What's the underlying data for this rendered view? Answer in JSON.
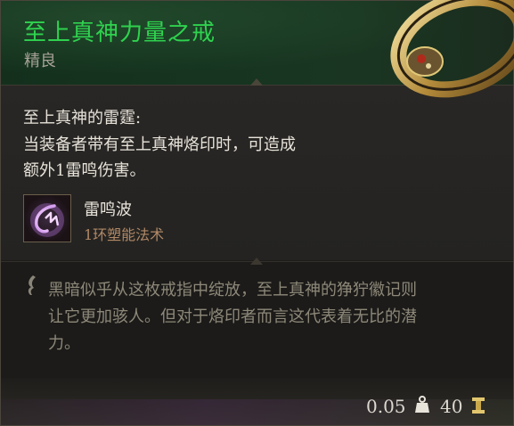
{
  "item": {
    "name": "至上真神力量之戒",
    "rarity": "精良",
    "name_color": "#2fd24f"
  },
  "passive": {
    "title": "至上真神的雷霆:",
    "description_lines": [
      "当装备者带有至上真神烙印时，可造成",
      "额外1雷鸣伤害。"
    ]
  },
  "spell": {
    "icon": "thunderwave-spell-icon",
    "name": "雷鸣波",
    "level": "1环塑能法术"
  },
  "lore": {
    "icon": "quill-icon",
    "lines": [
      "黑暗似乎从这枚戒指中绽放，至上真神的狰狞徽记则",
      "让它更加骇人。但对于烙印者而言这代表着无比的潜",
      "力。"
    ]
  },
  "footer": {
    "weight": "0.05",
    "weight_icon": "weight-icon",
    "price": "40",
    "price_icon": "gold-coin-icon"
  }
}
